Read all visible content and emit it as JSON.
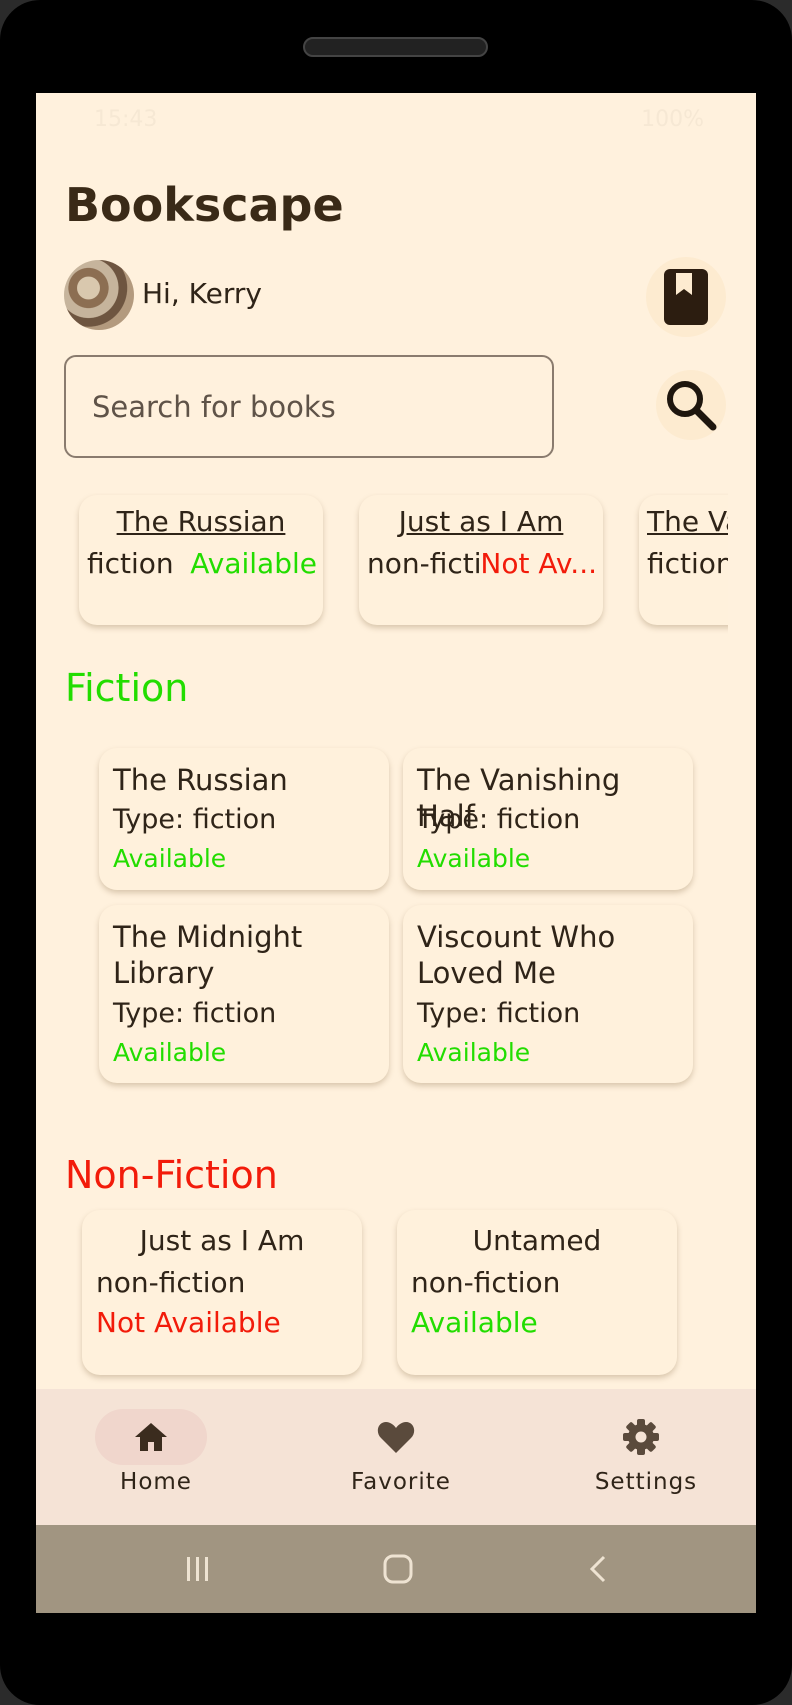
{
  "status_bar": {
    "time": "15:43",
    "indicators": "100%"
  },
  "app": {
    "title": "Bookscape"
  },
  "user": {
    "greeting": "Hi, Kerry"
  },
  "search": {
    "placeholder": "Search for books"
  },
  "carousel": [
    {
      "title": "The Russian",
      "type": "fiction",
      "status": "Available",
      "status_color": "#22dd00"
    },
    {
      "title": "Just as I Am",
      "type": "non-ficti",
      "status": "Not Av...",
      "status_color": "#f21b0a"
    },
    {
      "title": "The Va",
      "type": "fiction",
      "status": "",
      "status_color": "#22dd00"
    }
  ],
  "fiction": {
    "title": "Fiction",
    "color": "#22dd00",
    "books": [
      {
        "title": "The Russian",
        "type": "Type: fiction",
        "status": "Available"
      },
      {
        "title": "The Vanishing Half",
        "type": "Type: fiction",
        "status": "Available"
      },
      {
        "title": "The Midnight Library",
        "type": "Type: fiction",
        "status": "Available"
      },
      {
        "title": "Viscount Who Loved Me",
        "type": "Type: fiction",
        "status": "Available"
      }
    ]
  },
  "nonfiction": {
    "title": "Non-Fiction",
    "color": "#f21b0a",
    "books": [
      {
        "title": "Just as I Am",
        "type": "non-fiction",
        "status": "Not Available",
        "status_color": "#f21b0a"
      },
      {
        "title": "Untamed",
        "type": "non-fiction",
        "status": "Available",
        "status_color": "#22dd00"
      }
    ]
  },
  "bottom_nav": [
    {
      "label": "Home",
      "icon": "home-icon",
      "active": true
    },
    {
      "label": "Favorite",
      "icon": "heart-icon",
      "active": false
    },
    {
      "label": "Settings",
      "icon": "gear-icon",
      "active": false
    }
  ],
  "colors": {
    "background": "#fff1dd",
    "text": "#2f2418",
    "available": "#22dd00",
    "unavailable": "#f21b0a",
    "nav_bg": "#f5e3d6"
  }
}
